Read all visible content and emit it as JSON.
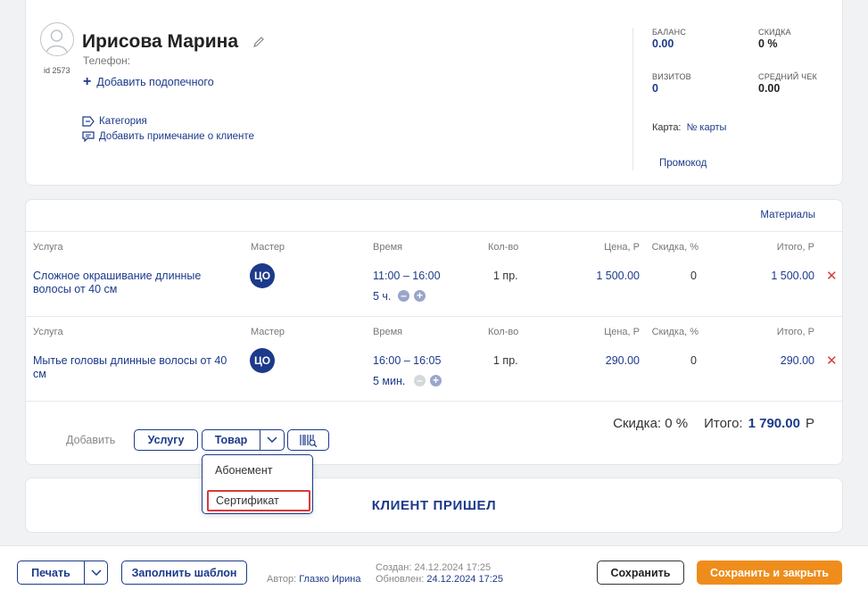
{
  "client": {
    "name": "Ирисова Марина",
    "id_label": "id 2573",
    "phone_label": "Телефон:",
    "add_ward": "Добавить подопечного",
    "category": "Категория",
    "add_note": "Добавить примечание о клиенте"
  },
  "stats": {
    "balance_label": "БАЛАНС",
    "balance_value": "0.00",
    "discount_label": "СКИДКА",
    "discount_value": "0 %",
    "visits_label": "ВИЗИТОВ",
    "visits_value": "0",
    "avg_check_label": "СРЕДНИЙ ЧЕК",
    "avg_check_value": "0.00",
    "card_label": "Карта:",
    "card_value": "№ карты",
    "promo": "Промокод"
  },
  "services": {
    "materials_link": "Материалы",
    "headers": {
      "service": "Услуга",
      "master": "Мастер",
      "time": "Время",
      "qty": "Кол-во",
      "price": "Цена, Р",
      "discount": "Скидка, %",
      "total": "Итого, Р"
    },
    "rows": [
      {
        "name_line1": "Сложное окрашивание длинные",
        "name_line2": "волосы от 40 см",
        "master": "ЦО",
        "time": "11:00 – 16:00",
        "duration": "5 ч.",
        "qty": "1 пр.",
        "price": "1 500.00",
        "discount": "0",
        "total": "1 500.00"
      },
      {
        "name_line1": "Мытье головы длинные волосы от 40",
        "name_line2": "см",
        "master": "ЦО",
        "time": "16:00 – 16:05",
        "duration": "5 мин.",
        "qty": "1 пр.",
        "price": "290.00",
        "discount": "0",
        "total": "290.00"
      }
    ],
    "summary": {
      "discount_text": "Скидка: 0 %",
      "total_label": "Итого:",
      "total_value": "1 790.00",
      "currency": "Р"
    },
    "add": {
      "label": "Добавить",
      "service_button": "Услугу",
      "product_button": "Товар"
    }
  },
  "dropdown": {
    "items": [
      "Абонемент",
      "Сертификат"
    ],
    "highlighted_index": 1
  },
  "client_arrived_button": "КЛИЕНТ ПРИШЕЛ",
  "footer": {
    "print_button": "Печать",
    "fill_template_button": "Заполнить шаблон",
    "author_label": "Автор:",
    "author_name": "Глазко Ирина",
    "created_label": "Создан:",
    "created_value": "24.12.2024 17:25",
    "updated_label": "Обновлен:",
    "updated_value": "24.12.2024 17:25",
    "save_button": "Сохранить",
    "save_close_button": "Сохранить и закрыть"
  },
  "colors": {
    "primary": "#1c3a8a",
    "accent": "#ee8d1c",
    "danger": "#d83a3a"
  }
}
